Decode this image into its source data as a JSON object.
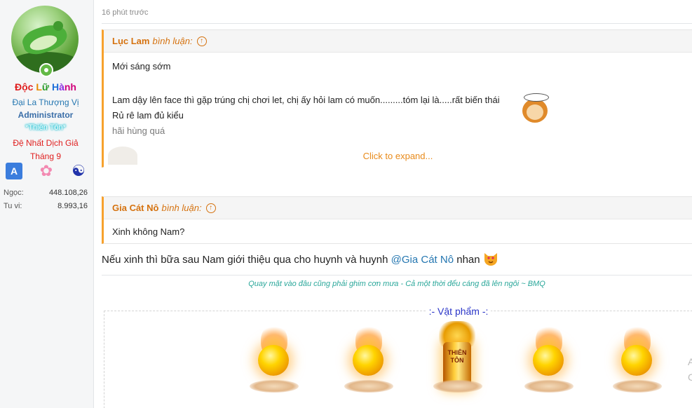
{
  "user": {
    "name_parts": [
      "Độc",
      " ",
      "Lữ",
      " ",
      "Hành"
    ],
    "rank": "Đại La Thượng Vị",
    "role": "Administrator",
    "title_badge": "*Thiên Tôn*",
    "medal_line1": "Đệ Nhất Dịch Giả",
    "medal_line2": "Tháng 9",
    "icons": [
      "translate-icon",
      "sakura-icon",
      "yin-yang-icon"
    ],
    "stats": [
      {
        "label": "Ngọc:",
        "value": "448.108,26"
      },
      {
        "label": "Tu vi:",
        "value": "8.993,16"
      }
    ]
  },
  "post": {
    "time": "16 phút trước",
    "quotes": [
      {
        "author": "Lục Lam",
        "action": "bình luận:",
        "lines": [
          "Mới sáng sớm",
          "Lam dậy lên face thì gặp trúng chị chơi let, chị ấy hỏi lam có muốn.........tóm lại là.....rất biến thái",
          "Rủ rê lam đủ kiểu",
          "hãi hùng quá"
        ],
        "expand": "Click to expand..."
      },
      {
        "author": "Gia Cát Nô",
        "action": "bình luận:",
        "lines": [
          "Xinh không Nam?"
        ]
      }
    ],
    "reply": {
      "before": "Nếu xinh thì bữa sau Nam giới thiệu qua cho huynh và huynh ",
      "mention": "@Gia Cát Nô",
      "after": " nhan"
    },
    "signature": "Quay mặt vào đâu cũng phải ghim cơn mưa - Cả một thời đểu cáng đã lên ngôi ~ BMQ",
    "items": {
      "title": ":- Vật phẩm -:",
      "center_label": "THIÊN TÔN"
    },
    "side_chars": [
      "A",
      "C"
    ]
  },
  "colors": {
    "quote_accent": "#f7a12d",
    "mention": "#2577b1",
    "signature": "#2aa79a",
    "items_title": "#2b36c8"
  }
}
